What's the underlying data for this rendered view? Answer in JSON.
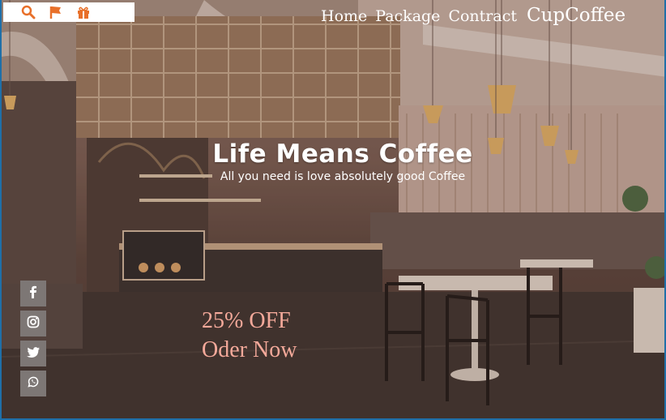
{
  "topbar": {
    "icons": [
      "search-icon",
      "flag-icon",
      "gift-icon"
    ],
    "icon_color": "#e8702a"
  },
  "nav": {
    "home": "Home",
    "package": "Package",
    "contract": "Contract",
    "brand": "CupCoffee"
  },
  "hero": {
    "title": "Life Means Coffee",
    "subtitle": "All you need is love absolutely good Coffee"
  },
  "promo": {
    "discount": "25% OFF",
    "cta": "Oder Now",
    "color": "#f4a99a"
  },
  "social": {
    "icons": [
      "facebook-icon",
      "instagram-icon",
      "twitter-icon",
      "whatsapp-icon"
    ],
    "bg_color": "#7d7775"
  }
}
